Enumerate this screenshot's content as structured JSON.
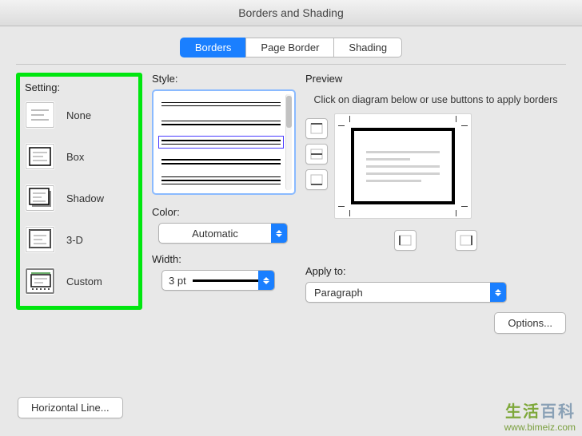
{
  "window": {
    "title": "Borders and Shading"
  },
  "segmented": {
    "borders": "Borders",
    "page_border": "Page Border",
    "shading": "Shading"
  },
  "setting": {
    "label": "Setting:",
    "none": "None",
    "box": "Box",
    "shadow": "Shadow",
    "threeD": "3-D",
    "custom": "Custom"
  },
  "style": {
    "label": "Style:",
    "color_label": "Color:",
    "color_value": "Automatic",
    "width_label": "Width:",
    "width_value": "3 pt"
  },
  "preview": {
    "label": "Preview",
    "hint": "Click on diagram below or use buttons to apply borders",
    "apply_label": "Apply to:",
    "apply_value": "Paragraph",
    "options_label": "Options..."
  },
  "footer": {
    "horizontal_line": "Horizontal Line..."
  },
  "watermark": {
    "cn1": "生活",
    "cn2": "百科",
    "url": "www.bimeiz.com"
  }
}
